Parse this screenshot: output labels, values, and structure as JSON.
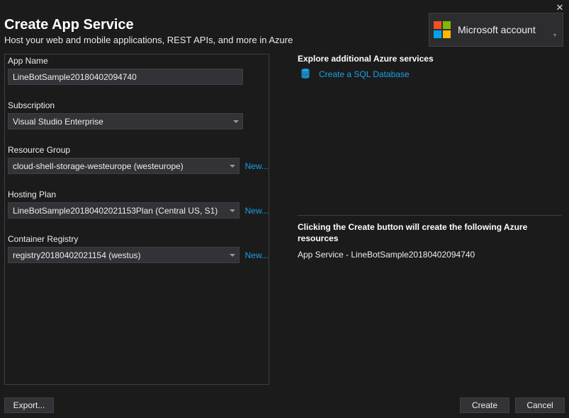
{
  "window": {
    "title": "Create App Service",
    "subtitle": "Host your web and mobile applications, REST APIs, and more in Azure",
    "close": "✕"
  },
  "account": {
    "label": "Microsoft account"
  },
  "form": {
    "appName": {
      "label": "App Name",
      "value": "LineBotSample20180402094740"
    },
    "subscription": {
      "label": "Subscription",
      "value": "Visual Studio Enterprise"
    },
    "resourceGroup": {
      "label": "Resource Group",
      "value": "cloud-shell-storage-westeurope (westeurope)",
      "new": "New..."
    },
    "hostingPlan": {
      "label": "Hosting Plan",
      "value": "LineBotSample20180402021153Plan (Central US, S1)",
      "new": "New..."
    },
    "containerRegistry": {
      "label": "Container Registry",
      "value": "registry20180402021154 (westus)",
      "new": "New..."
    }
  },
  "right": {
    "exploreHeading": "Explore additional Azure services",
    "sqlLink": "Create a SQL Database",
    "summaryHeading": "Clicking the Create button will create the following Azure resources",
    "summaryItem": "App Service - LineBotSample20180402094740"
  },
  "footer": {
    "export": "Export...",
    "create": "Create",
    "cancel": "Cancel"
  }
}
